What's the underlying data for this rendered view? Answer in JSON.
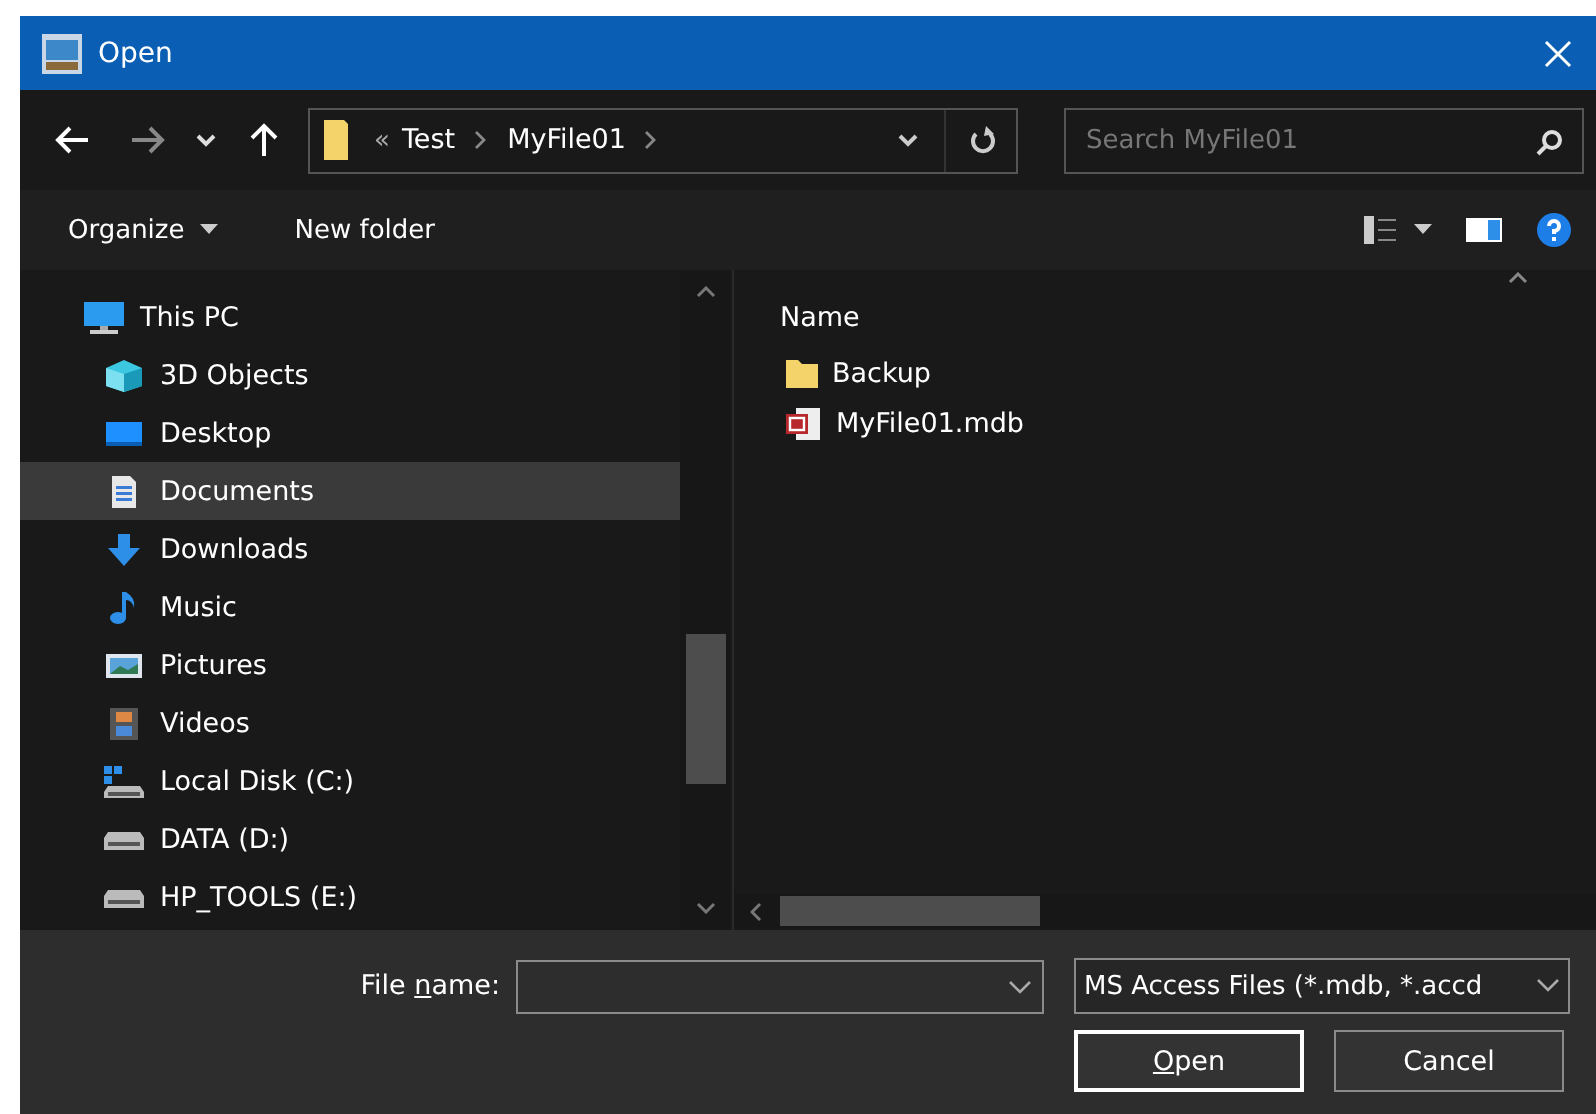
{
  "window": {
    "title": "Open"
  },
  "address_bar": {
    "overflow": "«",
    "segments": [
      "Test",
      "MyFile01"
    ]
  },
  "search": {
    "placeholder": "Search MyFile01"
  },
  "toolbar": {
    "organize": "Organize",
    "new_folder": "New folder"
  },
  "navigation_pane": {
    "items": [
      {
        "label": "This PC",
        "kind": "pc",
        "selected": false,
        "children": [
          {
            "label": "3D Objects",
            "kind": "objects3d",
            "selected": false
          },
          {
            "label": "Desktop",
            "kind": "desktop",
            "selected": false
          },
          {
            "label": "Documents",
            "kind": "documents",
            "selected": true
          },
          {
            "label": "Downloads",
            "kind": "downloads",
            "selected": false
          },
          {
            "label": "Music",
            "kind": "music",
            "selected": false
          },
          {
            "label": "Pictures",
            "kind": "pictures",
            "selected": false
          },
          {
            "label": "Videos",
            "kind": "videos",
            "selected": false
          },
          {
            "label": "Local Disk (C:)",
            "kind": "system-drive",
            "selected": false
          },
          {
            "label": "DATA (D:)",
            "kind": "drive",
            "selected": false
          },
          {
            "label": "HP_TOOLS (E:)",
            "kind": "drive",
            "selected": false
          }
        ]
      }
    ]
  },
  "file_list": {
    "columns": [
      "Name"
    ],
    "rows": [
      {
        "name": "Backup",
        "kind": "folder",
        "selected": false
      },
      {
        "name": "MyFile01.mdb",
        "kind": "access-db",
        "selected": false
      }
    ]
  },
  "file_name": {
    "label": {
      "before": "File ",
      "key": "n",
      "after": "ame:"
    }
  },
  "file_type": {
    "value": "MS Access Files (*.mdb, *.accd"
  },
  "buttons": [
    {
      "label": {
        "key": "O",
        "after": "pen"
      },
      "kind": "default"
    },
    {
      "label": {
        "before": "Cancel"
      },
      "kind": "normal"
    }
  ]
}
